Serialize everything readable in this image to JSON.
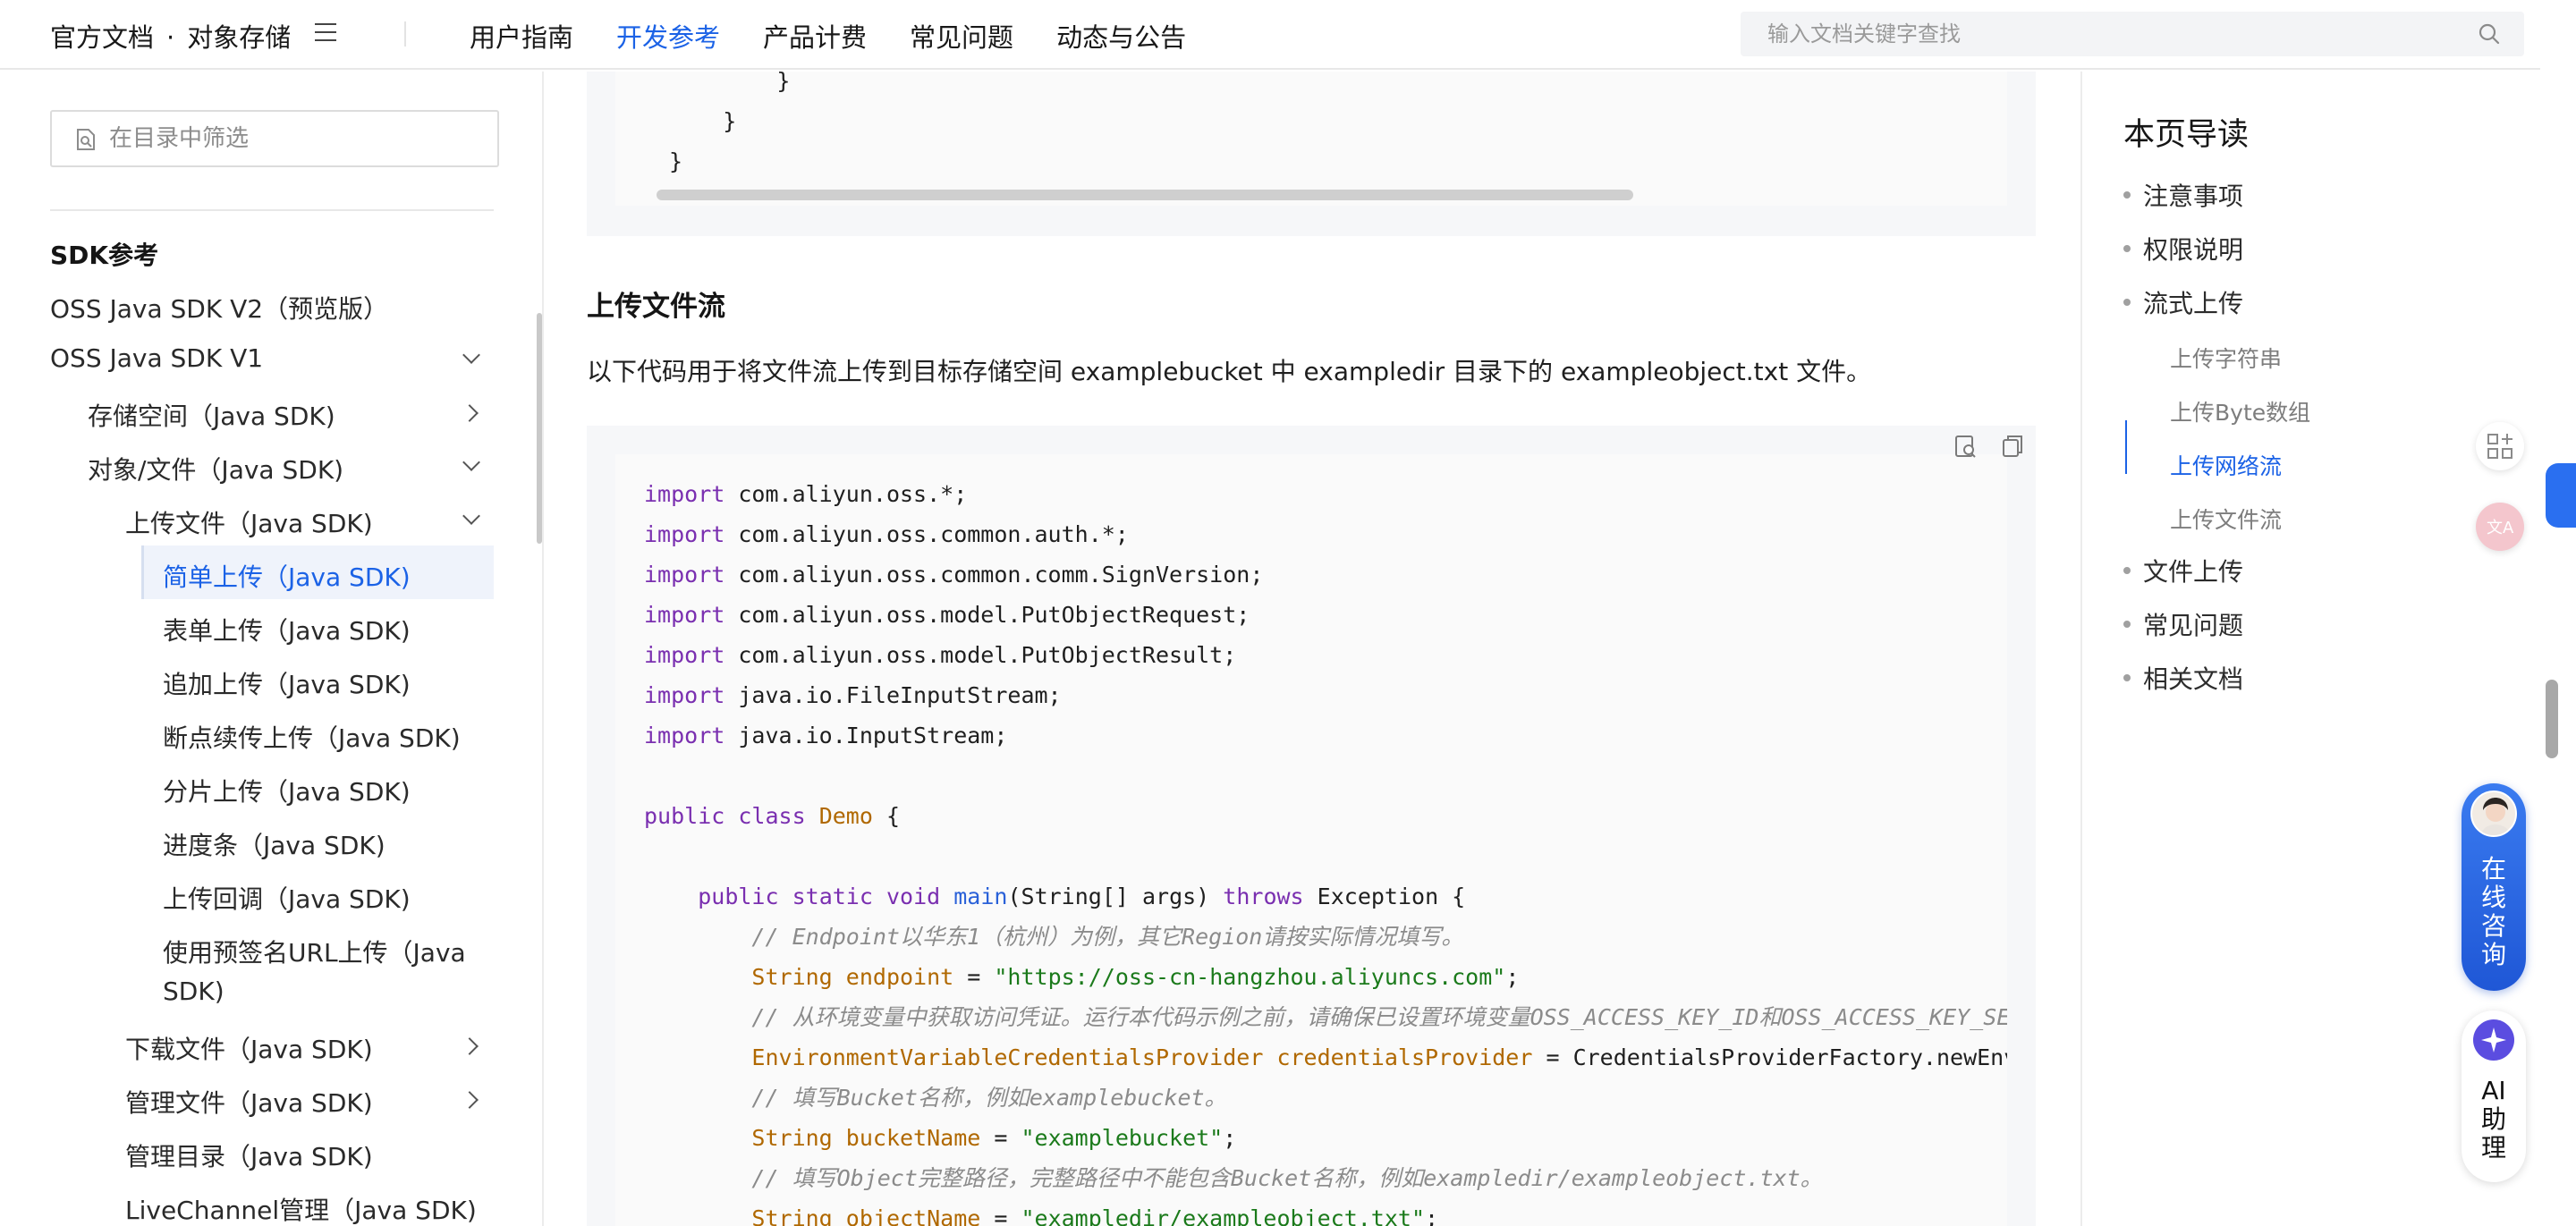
{
  "header": {
    "brand_docs": "官方文档",
    "brand_dot": "·",
    "brand_product": "对象存储",
    "nav": [
      {
        "label": "用户指南",
        "active": false
      },
      {
        "label": "开发参考",
        "active": true
      },
      {
        "label": "产品计费",
        "active": false
      },
      {
        "label": "常见问题",
        "active": false
      },
      {
        "label": "动态与公告",
        "active": false
      }
    ],
    "search_placeholder": "输入文档关键字查找"
  },
  "sidebar": {
    "filter_placeholder": "在目录中筛选",
    "items": [
      {
        "label": "SDK参考"
      },
      {
        "label": "OSS Java SDK V2（预览版）"
      },
      {
        "label": "OSS Java SDK V1"
      },
      {
        "label": "存储空间（Java SDK)"
      },
      {
        "label": "对象/文件（Java SDK)"
      },
      {
        "label": "上传文件（Java SDK)"
      },
      {
        "label": "简单上传（Java SDK)"
      },
      {
        "label": "表单上传（Java SDK)"
      },
      {
        "label": "追加上传（Java SDK)"
      },
      {
        "label": "断点续传上传（Java SDK)"
      },
      {
        "label": "分片上传（Java SDK)"
      },
      {
        "label": "进度条（Java SDK)"
      },
      {
        "label": "上传回调（Java SDK)"
      },
      {
        "label": "使用预签名URL上传（Java"
      },
      {
        "label": "SDK)"
      },
      {
        "label": "下载文件（Java SDK)"
      },
      {
        "label": "管理文件（Java SDK)"
      },
      {
        "label": "管理目录（Java SDK)"
      },
      {
        "label": "LiveChannel管理（Java SDK)"
      }
    ]
  },
  "main": {
    "prev_code_lines": [
      "        }",
      "    }",
      "}"
    ],
    "section_title": "上传文件流",
    "paragraph": "以下代码用于将文件流上传到目标存储空间 examplebucket 中 exampledir 目录下的 exampleobject.txt 文件。",
    "code": {
      "imports": [
        "com.aliyun.oss.*;",
        "com.aliyun.oss.common.auth.*;",
        "com.aliyun.oss.common.comm.SignVersion;",
        "com.aliyun.oss.model.PutObjectRequest;",
        "com.aliyun.oss.model.PutObjectResult;",
        "java.io.FileInputStream;",
        "java.io.InputStream;"
      ],
      "kw_import": "import",
      "kw_public": "public",
      "kw_class": "class",
      "class_name": "Demo",
      "brace_open": " {",
      "kw_static": "static",
      "kw_void": "void",
      "method": "main",
      "params": "(String[] args) ",
      "kw_throws": "throws",
      "exception": " Exception {",
      "comment1": "// Endpoint以华东1（杭州）为例，其它Region请按实际情况填写。",
      "type_string": "String",
      "var_endpoint": "endpoint",
      "eq": " = ",
      "val_endpoint": "\"https://oss-cn-hangzhou.aliyuncs.com\"",
      "semi": ";",
      "comment2": "// 从环境变量中获取访问凭证。运行本代码示例之前，请确保已设置环境变量OSS_ACCESS_KEY_ID和OSS_ACCESS_KEY_SECRET。",
      "type_provider": "EnvironmentVariableCredentialsProvider",
      "var_provider": "credentialsProvider",
      "provider_rhs": "CredentialsProviderFactory.newEnvironmentVariableCredentialsProvider();",
      "comment3": "// 填写Bucket名称，例如examplebucket。",
      "var_bucket": "bucketName",
      "val_bucket": "\"examplebucket\"",
      "comment4": "// 填写Object完整路径，完整路径中不能包含Bucket名称，例如exampledir/exampleobject.txt。",
      "var_object": "objectName",
      "val_object": "\"exampledir/exampleobject.txt\""
    }
  },
  "toc": {
    "title": "本页导读",
    "items": [
      {
        "label": "注意事项"
      },
      {
        "label": "权限说明"
      },
      {
        "label": "流式上传"
      },
      {
        "label": "上传字符串",
        "sub": true
      },
      {
        "label": "上传Byte数组",
        "sub": true
      },
      {
        "label": "上传网络流",
        "sub": true,
        "active": true
      },
      {
        "label": "上传文件流",
        "sub": true
      },
      {
        "label": "文件上传"
      },
      {
        "label": "常见问题"
      },
      {
        "label": "相关文档"
      }
    ]
  },
  "widgets": {
    "online_label": [
      "在",
      "线",
      "咨",
      "询"
    ],
    "ai_label": [
      "AI",
      "助",
      "理"
    ]
  },
  "colors": {
    "accent": "#1b62e6",
    "keyword": "#7a2fb0",
    "class": "#b06800",
    "string": "#1b7a1b",
    "comment": "#8b8b8b"
  }
}
